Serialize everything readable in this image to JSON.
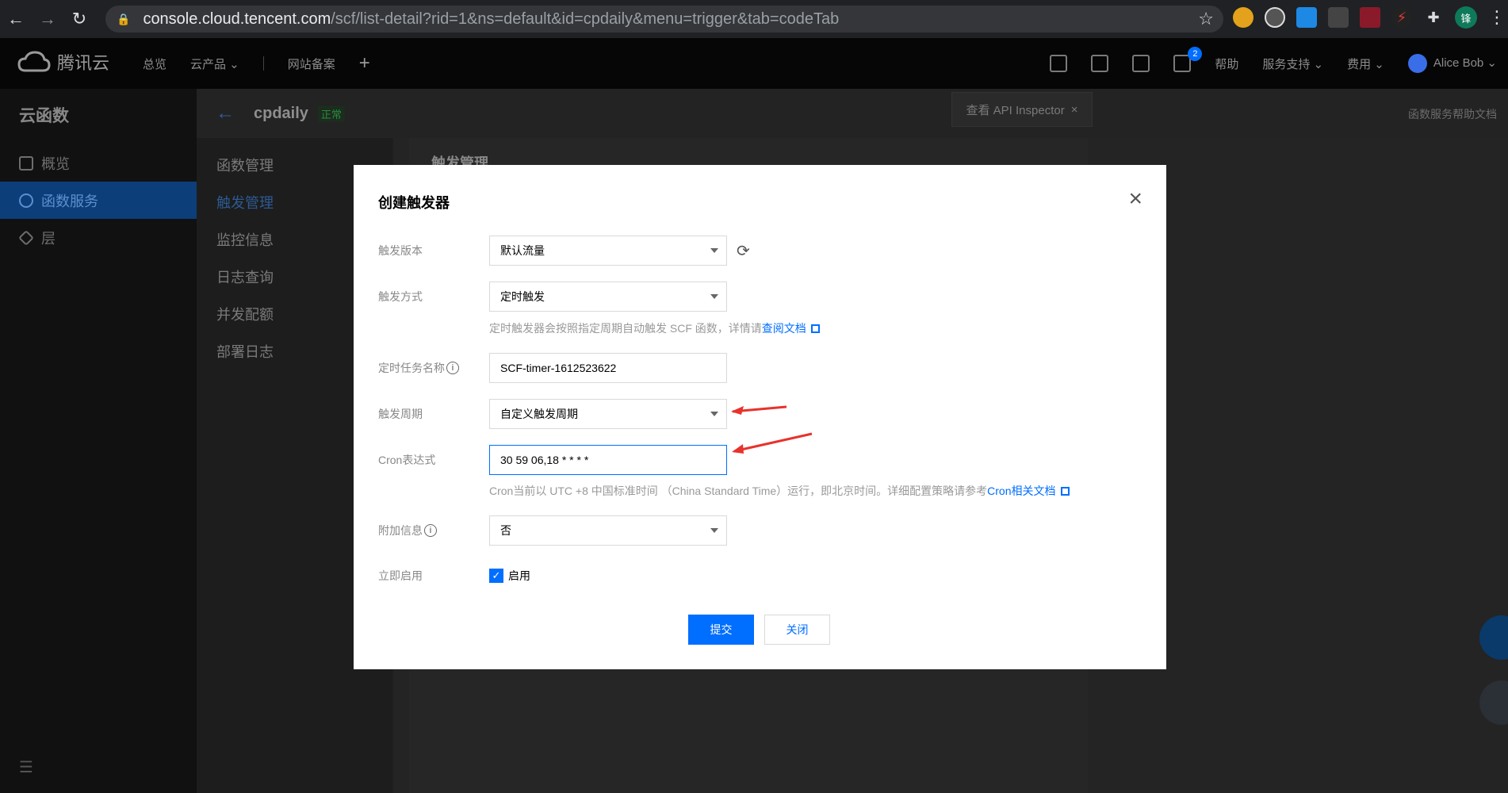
{
  "browser": {
    "url_host": "console.cloud.tencent.com",
    "url_path": "/scf/list-detail?rid=1&ns=default&id=cpdaily&menu=trigger&tab=codeTab",
    "profile_initial": "锋"
  },
  "topnav": {
    "logo_text": "腾讯云",
    "items": [
      "总览",
      "云产品 ⌄",
      "网站备案"
    ],
    "help": "帮助",
    "service_support": "服务支持 ⌄",
    "billing": "费用 ⌄",
    "user": "Alice Bob ⌄",
    "mail_badge": "2"
  },
  "sidebar": {
    "title": "云函数",
    "items": [
      {
        "label": "概览"
      },
      {
        "label": "函数服务"
      },
      {
        "label": "层"
      }
    ]
  },
  "page": {
    "function_name": "cpdaily",
    "status": "正常",
    "help_link": "函数服务帮助文档",
    "api_inspector": "查看 API Inspector",
    "section_title": "触发管理",
    "subnav": [
      "函数管理",
      "触发管理",
      "监控信息",
      "日志查询",
      "并发配额",
      "部署日志"
    ]
  },
  "modal": {
    "title": "创建触发器",
    "fields": {
      "version_label": "触发版本",
      "version_value": "默认流量",
      "method_label": "触发方式",
      "method_value": "定时触发",
      "method_hint": "定时触发器会按照指定周期自动触发 SCF 函数，详情请",
      "method_hint_link": "查阅文档",
      "task_name_label": "定时任务名称",
      "task_name_value": "SCF-timer-1612523622",
      "period_label": "触发周期",
      "period_value": "自定义触发周期",
      "cron_label": "Cron表达式",
      "cron_value": "30 59 06,18 * * * *",
      "cron_hint": "Cron当前以 UTC +8 中国标准时间 （China Standard Time）运行，即北京时间。详细配置策略请参考",
      "cron_hint_link": "Cron相关文档",
      "extra_label": "附加信息",
      "extra_value": "否",
      "enable_label": "立即启用",
      "enable_checkbox_label": "启用"
    },
    "submit": "提交",
    "close": "关闭"
  },
  "colors": {
    "primary": "#006eff",
    "annotation_arrow": "#e8322b"
  }
}
